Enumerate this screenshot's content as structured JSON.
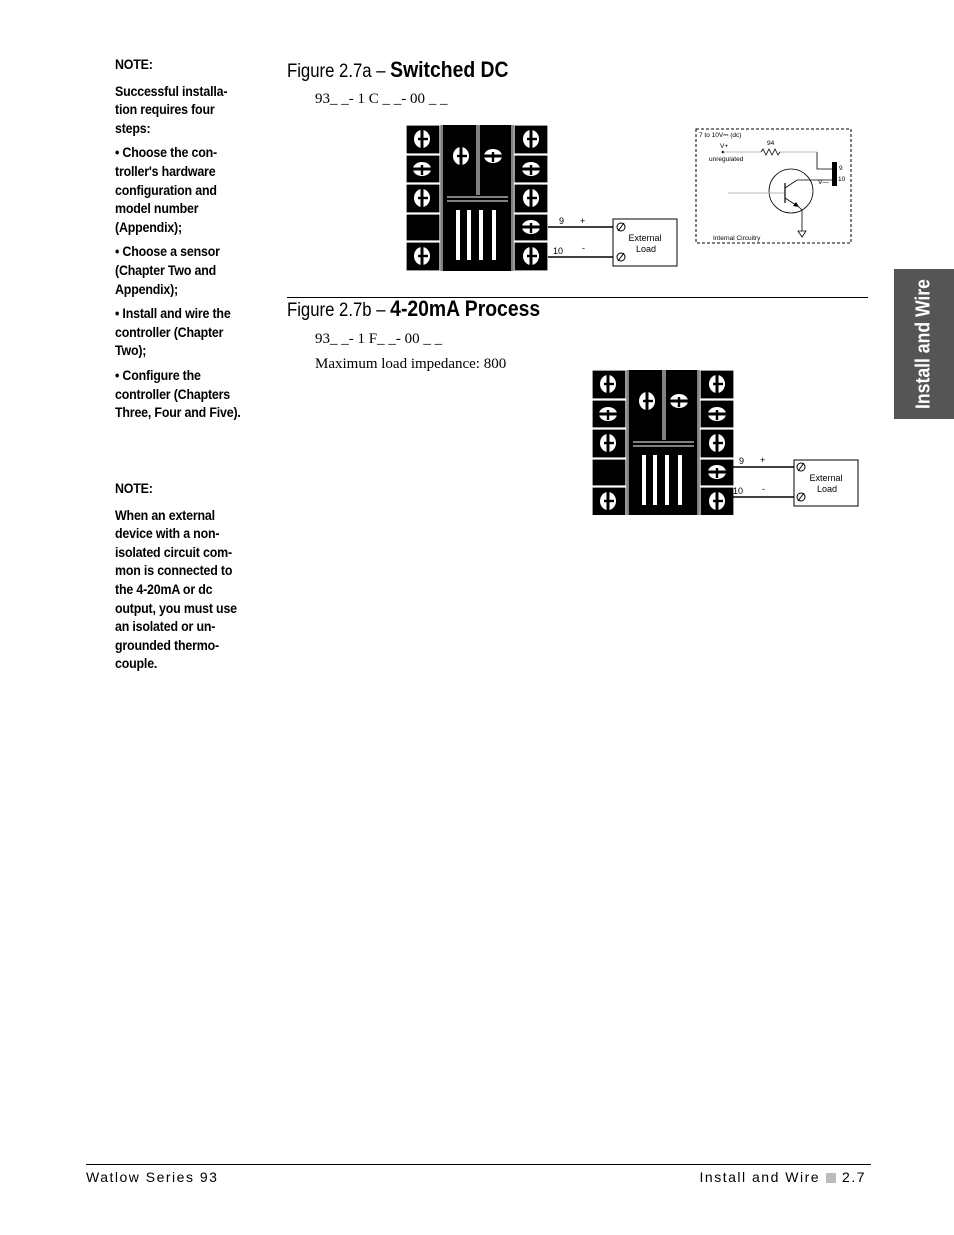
{
  "sidebar": {
    "note1_heading": "NOTE:",
    "note1_intro": "Successful installa- tion requires four steps:",
    "steps": [
      "• Choose the con- troller's hardware configuration and model number (Appendix);",
      "• Choose a sensor (Chapter Two and Appendix);",
      "• Install and wire the controller (Chapter Two);",
      "• Configure the controller (Chapters Three, Four and Five)."
    ],
    "note2_heading": "NOTE:",
    "note2_body": "When an external device with a non- isolated circuit com- mon is connected to the 4-20mA or dc output, you must use an isolated or un- grounded thermo- couple."
  },
  "figure_a": {
    "prefix": "Figure 2.7a – ",
    "title": "Switched DC",
    "model": "93_ _- 1 C _ _- 00 _ _",
    "terminal_labels": {
      "t9": "9",
      "t10": "10",
      "plus": "+",
      "minus": "-"
    },
    "load_label": [
      "External",
      "Load"
    ],
    "circuit": {
      "voltage": "7 to 10V⎓ (dc)",
      "vplus": "V+",
      "unregulated": "unregulated",
      "resistor": "94",
      "pin9": "9",
      "pin10": "10",
      "vminus": "V—",
      "caption": "Internal Circuitry"
    }
  },
  "figure_b": {
    "prefix": "Figure 2.7b – ",
    "title": "4-20mA Process",
    "model": "93_ _- 1 F_ _- 00 _ _",
    "impedance": "Maximum load impedance: 800",
    "terminal_labels": {
      "t9": "9",
      "t10": "10",
      "plus": "+",
      "minus": "-"
    },
    "load_label": [
      "External",
      "Load"
    ]
  },
  "side_tab": "Install and Wire",
  "footer": {
    "left": "Watlow Series 93",
    "right_section": "Install and Wire",
    "page": "2.7"
  }
}
